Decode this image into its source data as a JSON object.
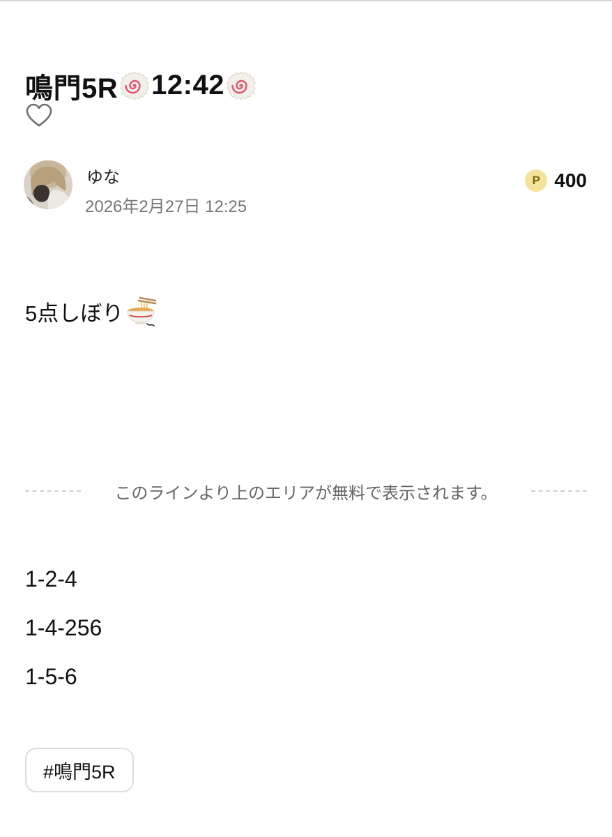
{
  "post": {
    "title_prefix": "鳴門5R",
    "title_time": "12:42",
    "title_emoji": "fish-cake-emoji",
    "like_icon": "heart-outline-icon"
  },
  "author": {
    "name": "ゆな",
    "date": "2026年2月27日 12:25",
    "avatar": "user-avatar-photo"
  },
  "price": {
    "badge": "P",
    "value": "400",
    "badge_color": "#f4e39a"
  },
  "content": {
    "intro": "5点しぼり",
    "intro_emoji": "ramen-bowl-emoji",
    "paywall_message": "このラインより上のエリアが無料で表示されます。",
    "combinations": [
      "1-2-4",
      "1-4-256",
      "1-5-6"
    ]
  },
  "tags": [
    "#鳴門5R"
  ]
}
